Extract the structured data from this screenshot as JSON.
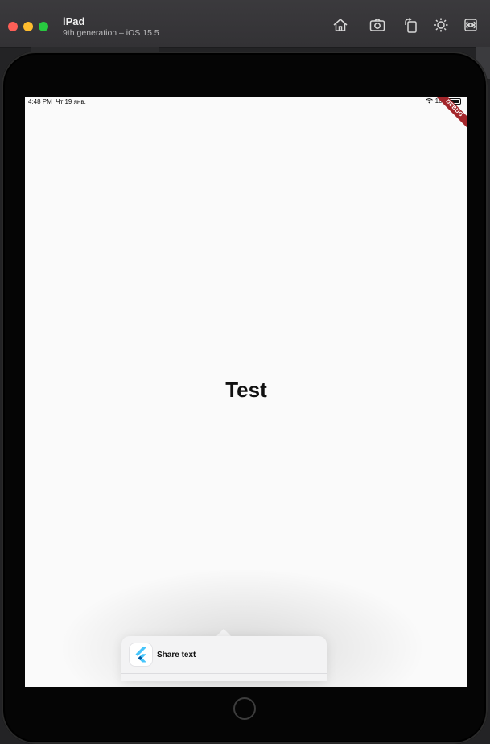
{
  "window": {
    "title": "iPad",
    "subtitle": "9th generation – iOS 15.5",
    "toolbar_icons": [
      "home-icon",
      "screenshot-icon",
      "rotate-icon",
      "appearance-icon",
      "command-icon"
    ]
  },
  "status_bar": {
    "time": "4:48 PM",
    "date": "Чт 19 янв.",
    "battery": "100"
  },
  "debug_banner": "DEBUG",
  "main": {
    "text": "Test"
  },
  "share_popover": {
    "label": "Share text",
    "app_icon": "flutter-icon"
  },
  "colors": {
    "debug_banner": "#a3262b",
    "screen_background": "#fafafa",
    "flutter_blue": "#47c5fb"
  }
}
